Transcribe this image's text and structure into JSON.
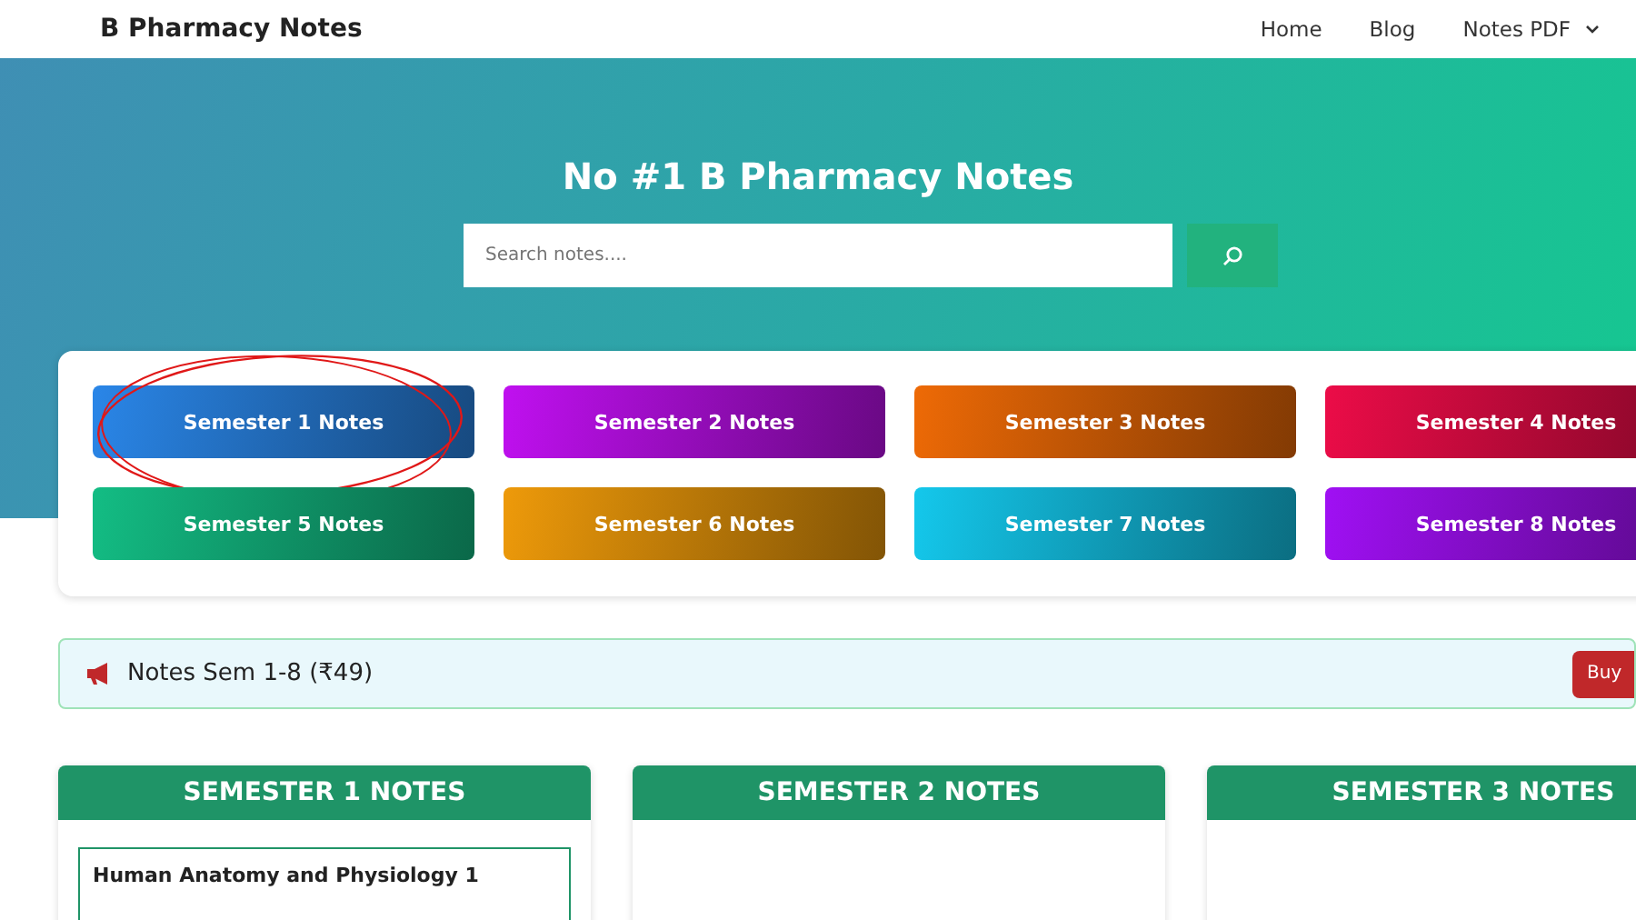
{
  "header": {
    "brand": "B Pharmacy Notes",
    "nav": [
      {
        "label": "Home",
        "dropdown": false
      },
      {
        "label": "Blog",
        "dropdown": false
      },
      {
        "label": "Notes PDF",
        "dropdown": true
      }
    ]
  },
  "hero": {
    "title": "No #1 B Pharmacy Notes",
    "search": {
      "placeholder": "Search notes...."
    }
  },
  "semester_buttons": [
    {
      "label": "Semester 1 Notes",
      "color": "#2a86e8",
      "circled": true
    },
    {
      "label": "Semester 2 Notes",
      "color": "#c010f0",
      "circled": false
    },
    {
      "label": "Semester 3 Notes",
      "color": "#ee6a06",
      "circled": false
    },
    {
      "label": "Semester 4 Notes",
      "color": "#ec0c48",
      "circled": false
    },
    {
      "label": "Semester 5 Notes",
      "color": "#13bd84",
      "circled": false
    },
    {
      "label": "Semester 6 Notes",
      "color": "#ee9a0a",
      "circled": false
    },
    {
      "label": "Semester 7 Notes",
      "color": "#14c8ec",
      "circled": false
    },
    {
      "label": "Semester 8 Notes",
      "color": "#a010f4",
      "circled": false
    }
  ],
  "announcement": {
    "text": "Notes Sem 1-8 (₹49)",
    "button": "Buy"
  },
  "semester_cards": [
    {
      "title": "SEMESTER 1 NOTES",
      "subjects": [
        "Human Anatomy and Physiology 1"
      ]
    },
    {
      "title": "SEMESTER 2 NOTES"
    },
    {
      "title": "SEMESTER 3 NOTES"
    }
  ]
}
